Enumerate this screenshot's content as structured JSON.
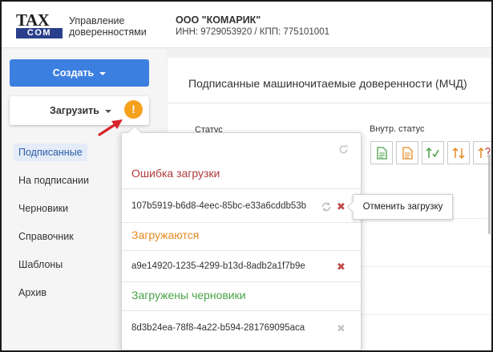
{
  "header": {
    "logo_top": "TAX",
    "logo_bottom": "COM",
    "app_title_line1": "Управление",
    "app_title_line2": "доверенностями",
    "org_name": "ООО \"КОМАРИК\"",
    "org_ids": "ИНН: 9729053920 / КПП: 775101001"
  },
  "sidebar": {
    "create_label": "Создать",
    "upload_label": "Загрузить",
    "upload_warning": "!",
    "items": [
      {
        "label": "Подписанные",
        "active": true
      },
      {
        "label": "На подписании"
      },
      {
        "label": "Черновики"
      },
      {
        "label": "Справочник"
      },
      {
        "label": "Шаблоны"
      },
      {
        "label": "Архив"
      }
    ]
  },
  "main": {
    "title": "Подписанные машиночитаемые доверенности (МЧД)",
    "status_label": "Статус",
    "inner_status_label": "Внутр. статус"
  },
  "upload_popup": {
    "error_title": "Ошибка загрузки",
    "error_files": [
      "107b5919-b6d8-4eec-85bc-e33a6cddb53b"
    ],
    "loading_title": "Загружаются",
    "loading_files": [
      "a9e14920-1235-4299-b13d-8adb2a1f7b9e"
    ],
    "done_title": "Загружены черновики",
    "done_files": [
      "8d3b24ea-78f8-4a22-b594-281769095aca"
    ]
  },
  "tooltip": {
    "text": "Отменить загрузку"
  },
  "colors": {
    "accent_blue": "#3b7fe0",
    "warning_orange": "#f5a11c",
    "error_red": "#b03a3a",
    "loading_orange": "#e48a22",
    "success_green": "#4aa24a"
  }
}
